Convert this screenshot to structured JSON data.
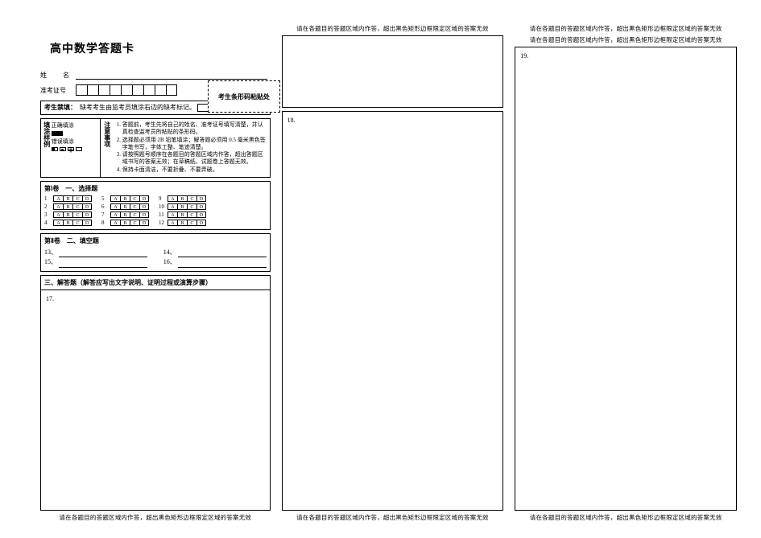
{
  "title": "高中数学答题卡",
  "labels": {
    "name": "姓　名",
    "exam_id": "准考证号"
  },
  "barcode_label": "考生条形码粘贴处",
  "notice1": {
    "head": "考生禁填：",
    "text": "缺考考生由监考员填涂右边的缺考标记。"
  },
  "example": {
    "left_title": "填涂样例",
    "correct": "正确填涂",
    "wrong": "错误填涂",
    "right_title": "注意事项",
    "items": [
      "答题前，考生先将自己的姓名、准考证号填写清楚，并认真检查监考员所粘贴的条形码。",
      "选择题必须用 2B 铅笔填涂；解答题必须用 0.5 毫米黑色签字笔书写，字体工整、笔迹清楚。",
      "请按照题号顺序在各题目的答题区域内作答，超出答题区域书写的答案无效；在草稿纸、试题卷上答题无效。",
      "保持卡面清洁，不要折叠、不要弄破。"
    ]
  },
  "sections": {
    "part1": "第Ⅰ卷　一、选择题",
    "part2": "第Ⅱ卷　二、填空题",
    "part3": "三、解答题（解答应写出文字说明、证明过程或演算步骤）"
  },
  "mc": {
    "options": [
      "A",
      "B",
      "C",
      "D"
    ],
    "cols": [
      [
        "1",
        "2",
        "3",
        "4"
      ],
      [
        "5",
        "6",
        "7",
        "8"
      ],
      [
        "9",
        "10",
        "11",
        "12"
      ]
    ]
  },
  "fill": {
    "rows": [
      [
        "13、",
        "14、"
      ],
      [
        "15、",
        "16、"
      ]
    ]
  },
  "answers": {
    "q17": "17.",
    "q18": "18.",
    "q19": "19."
  },
  "boundary_note": "请在各题目的答题区域内作答，超出黑色矩形边框限定区域的答案无效"
}
